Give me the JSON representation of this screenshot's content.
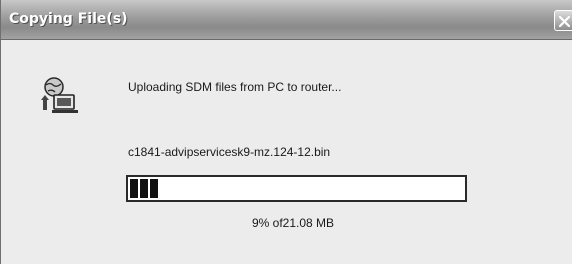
{
  "window": {
    "title": "Copying File(s)"
  },
  "dialog": {
    "message": "Uploading SDM files from PC to router...",
    "filename": "c1841-advipservicesk9-mz.124-12.bin",
    "progress_text": "9% of21.08 MB",
    "progress_fraction": 0.09
  },
  "icons": {
    "app": "computer-transfer-icon",
    "close": "close-icon"
  },
  "colors": {
    "titlebar": "#9c9c9c",
    "window_bg": "#ececec",
    "progress_fill": "#111111"
  }
}
